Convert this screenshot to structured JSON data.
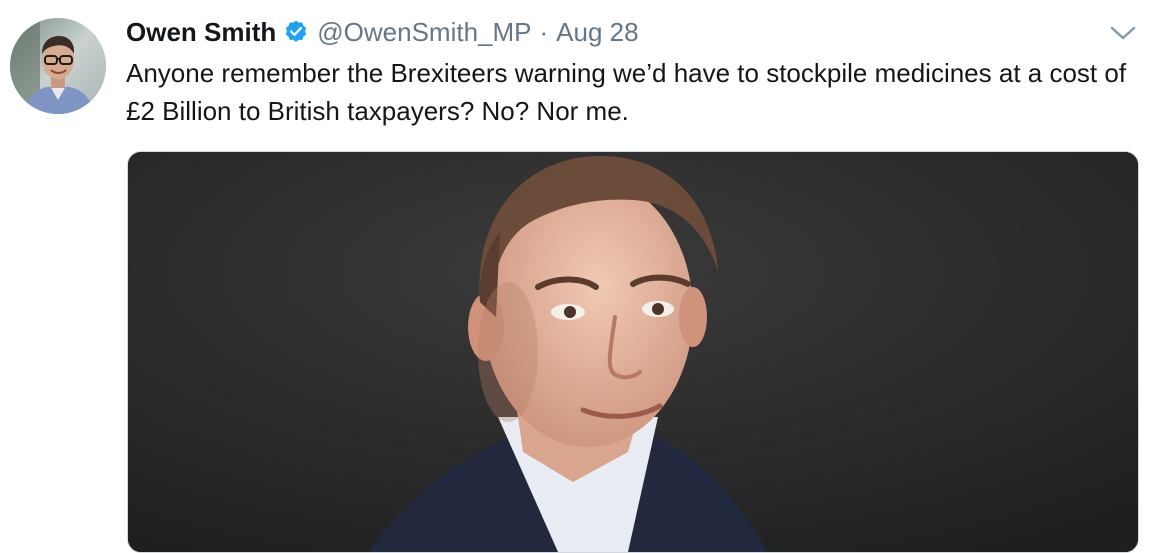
{
  "tweet": {
    "author_name": "Owen Smith",
    "handle": "@OwenSmith_MP",
    "separator": "·",
    "timestamp": "Aug 28",
    "text": "Anyone remember the Brexiteers warning we’d have to stockpile medicines at a cost of £2 Billion to British taxpayers? No? Nor me.",
    "verified": true
  },
  "icons": {
    "verified": "verified-badge-icon",
    "menu": "chevron-down-icon"
  },
  "colors": {
    "name": "#14171a",
    "secondary": "#657786",
    "verified_blue": "#1da1f2",
    "media_background": "#2b2b2b"
  }
}
